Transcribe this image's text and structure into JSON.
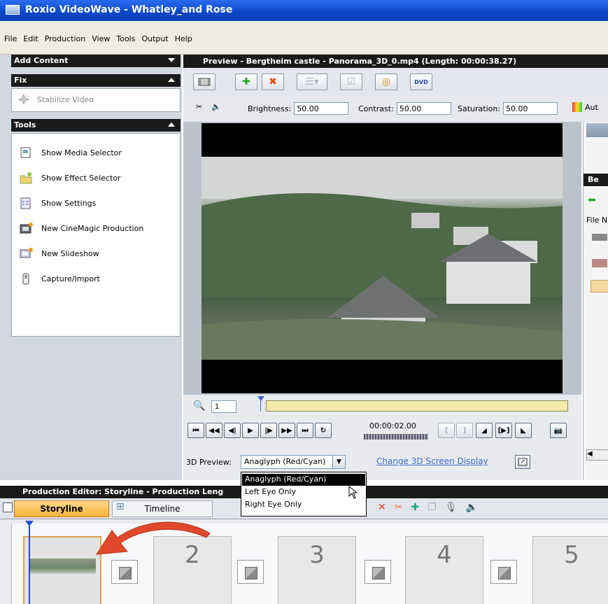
{
  "window": {
    "title": "Roxio VideoWave - Whatley_and Rose"
  },
  "menu": [
    "File",
    "Edit",
    "Production",
    "View",
    "Tools",
    "Output",
    "Help"
  ],
  "left_panel": {
    "add_content": "Add Content",
    "fix": {
      "header": "Fix",
      "item": "Stabilize Video"
    },
    "tools": {
      "header": "Tools",
      "items": [
        "Show Media Selector",
        "Show Effect Selector",
        "Show Settings",
        "New CineMagic Production",
        "New Slideshow",
        "Capture/Import"
      ]
    }
  },
  "preview": {
    "header": "Preview - Bergtheim castle - Panorama_3D_0.mp4 (Length: 00:00:38.27)",
    "adjust": {
      "brightness_label": "Brightness:",
      "brightness": "50.00",
      "contrast_label": "Contrast:",
      "contrast": "50.00",
      "saturation_label": "Saturation:",
      "saturation": "50.00",
      "auto_label": "Aut"
    },
    "zoom_value": "1",
    "timecode": "00:00:02.00",
    "preview3d_label": "3D Preview:",
    "preview3d_value": "Anaglyph (Red/Cyan)",
    "preview3d_options": [
      "Anaglyph (Red/Cyan)",
      "Left Eye Only",
      "Right Eye Only"
    ],
    "change_link": "Change 3D Screen Display"
  },
  "right_panel": {
    "header_partial": "Be",
    "file_label_partial": "File N"
  },
  "production": {
    "header": "Production Editor: Storyline - Production Leng",
    "tabs": {
      "storyline": "Storyline",
      "timeline": "Timeline"
    },
    "slots": [
      "2",
      "3",
      "4",
      "5"
    ]
  },
  "colors": {
    "accent_orange": "#f3b03a",
    "title_blue": "#0a47c8",
    "link_blue": "#3b6fd6",
    "arrow_red": "#e04a2a"
  }
}
